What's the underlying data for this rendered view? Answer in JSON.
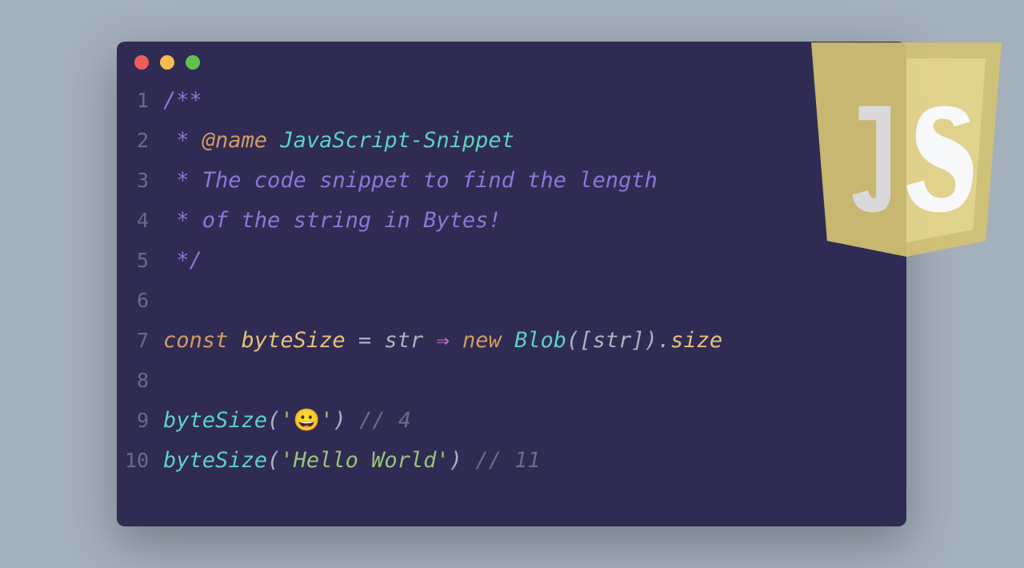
{
  "window": {
    "controls": {
      "red": "#ec5f59",
      "yellow": "#f4be4f",
      "green": "#5fc24e"
    }
  },
  "logo": {
    "label": "JS"
  },
  "code": {
    "line_numbers": [
      "1",
      "2",
      "3",
      "4",
      "5",
      "6",
      "7",
      "8",
      "9",
      "10"
    ],
    "l1": {
      "t1": "/**"
    },
    "l2": {
      "t1": " * ",
      "tag": "@name",
      "sp": " ",
      "name": "JavaScript-Snippet"
    },
    "l3": {
      "t1": " * ",
      "text": "The code snippet to find the length"
    },
    "l4": {
      "t1": " * ",
      "text": "of the string in Bytes!"
    },
    "l5": {
      "t1": " */"
    },
    "l7": {
      "kw": "const",
      "sp1": " ",
      "id": "byteSize",
      "sp2": " ",
      "eq": "=",
      "sp3": " ",
      "param": "str",
      "sp4": " ",
      "arrow": "⇒",
      "sp5": " ",
      "kw2": "new",
      "sp6": " ",
      "cls": "Blob",
      "po": "(",
      "bo": "[",
      "p2": "str",
      "bc": "]",
      "pc": ")",
      "dot": ".",
      "prop": "size"
    },
    "l9": {
      "fn": "byteSize",
      "po": "(",
      "q1": "'",
      "emoji": "😀",
      "q2": "'",
      "pc": ")",
      "sp": " ",
      "cm": "//",
      "sp2": " ",
      "num": "4"
    },
    "l10": {
      "fn": "byteSize",
      "po": "(",
      "q1": "'",
      "str": "Hello World",
      "q2": "'",
      "pc": ")",
      "sp": " ",
      "cm": "//",
      "sp2": " ",
      "num": "11"
    }
  }
}
